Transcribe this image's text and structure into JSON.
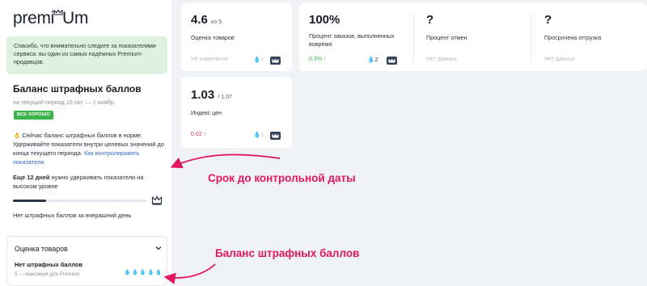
{
  "brand": {
    "logo_pre": "premi",
    "logo_post": "m"
  },
  "sidebar": {
    "notice": "Спасибо, что внимательно следите за показателями сервиса: вы один из самых надёжных Premium-продавцов.",
    "balance": {
      "title": "Баланс штрафных баллов",
      "period": "на текущий период 16 окт. — 1 ноябр.",
      "badge": "ВСЕ ХОРОШО",
      "text": "👌 Сейчас баланс штрафных баллов в норме. Удерживайте показатели внутри целевых значений до конца текущего периода.",
      "link": "Как контролировать показатели",
      "deadline_bold": "Еще 12 дней",
      "deadline_rest": " нужно удерживать показатели на высоком уровне",
      "progress": 0.25,
      "no_points": "Нет штрафных баллов за вчерашний день"
    },
    "rating_card": {
      "header": "Оценка товаров",
      "status": "Нет штрафных баллов",
      "max_text": "5 — максимум для Premium",
      "drops": "💧💧💧💧💧"
    }
  },
  "metrics": {
    "rating": {
      "value": "4.6",
      "suffix": "из 5",
      "label": "Оценка товаров",
      "status": "Не изменился",
      "drops": "0"
    },
    "on_time": {
      "value": "100%",
      "label": "Процент заказов, выполненных вовремя",
      "status": "0.3% ↑",
      "drops": "2"
    },
    "cancels": {
      "value": "?",
      "label": "Процент отмен",
      "status": "Нет данных"
    },
    "late": {
      "value": "?",
      "label": "Просрочена отгрузка",
      "status": "Нет данных"
    },
    "price": {
      "value": "1.03",
      "suffix": "/ 1.07",
      "label": "Индекс цен",
      "status": "0.02 ↑",
      "drops": "0"
    }
  },
  "annotations": {
    "deadline": "Срок до контрольной даты",
    "balance": "Баланс штрафных баллов"
  },
  "colors": {
    "accent": "#e2175e",
    "good": "#3bb54a",
    "link": "#3466c9",
    "dark": "#33415a"
  },
  "icons": [
    "crown-icon",
    "drop-icon",
    "chevron-down-icon",
    "ok-hand-icon"
  ]
}
